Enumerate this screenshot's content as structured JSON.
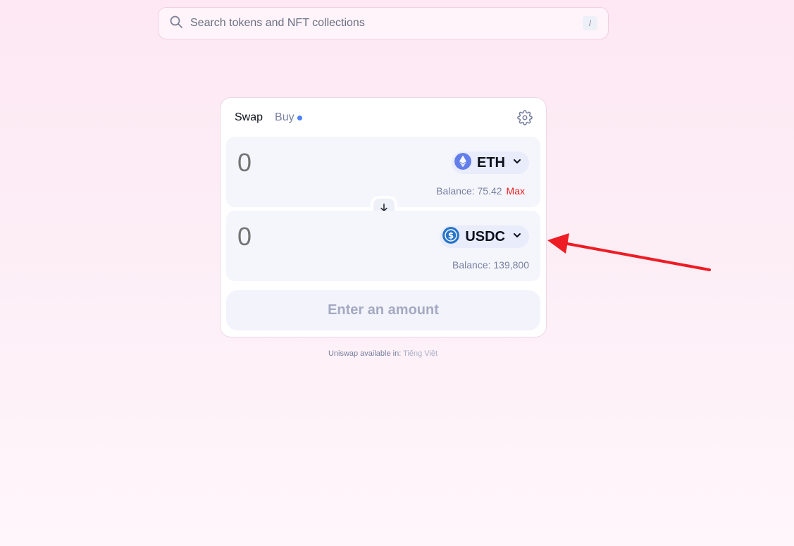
{
  "search": {
    "placeholder": "Search tokens and NFT collections",
    "shortcut": "/",
    "icon": "search-icon"
  },
  "swap": {
    "tabs": [
      {
        "label": "Swap",
        "active": true
      },
      {
        "label": "Buy",
        "active": false
      }
    ],
    "settings_icon": "gear-icon",
    "input": {
      "amount": "0",
      "token": "ETH",
      "token_icon": "eth-icon",
      "balance_label": "Balance: 75.42",
      "max_label": "Max"
    },
    "output": {
      "amount": "0",
      "token": "USDC",
      "token_icon": "usdc-icon",
      "balance_label": "Balance: 139,800"
    },
    "action_label": "Enter an amount"
  },
  "footer": {
    "prefix": "Uniswap available in: ",
    "language": "Tiếng Việt"
  },
  "colors": {
    "accent_blue": "#4c82fb",
    "max_red": "#e81d1d",
    "annotation_red": "#ee1c24",
    "eth_blue": "#627eea",
    "usdc_blue": "#2775ca"
  }
}
